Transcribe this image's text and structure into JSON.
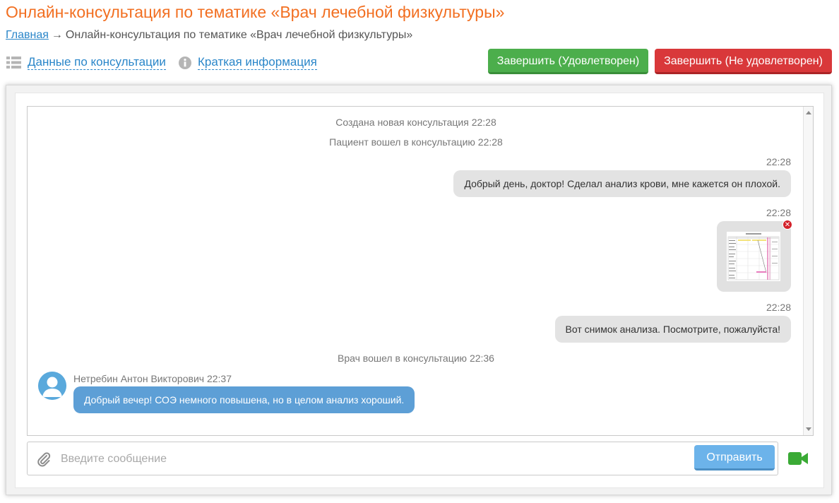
{
  "page": {
    "title": "Онлайн-консультация по тематике «Врач лечебной физкультуры»"
  },
  "breadcrumb": {
    "home": "Главная",
    "arrow": "→",
    "current": "Онлайн-консультация по тематике «Врач лечебной физкультуры»"
  },
  "toolbar": {
    "data_link": "Данные по консультации",
    "data_icon": "list-icon",
    "info_link": "Краткая информация",
    "info_icon": "info-icon",
    "finish_ok": "Завершить (Удовлетворен)",
    "finish_bad": "Завершить (Не удовлетворен)"
  },
  "chat": {
    "events": [
      {
        "text": "Создана новая консультация",
        "time": "22:28"
      },
      {
        "text": "Пациент вошел в консультацию",
        "time": "22:28"
      },
      {
        "text": "Врач вошел в консультацию",
        "time": "22:36"
      }
    ],
    "outgoing": [
      {
        "time": "22:28",
        "text": "Добрый день, доктор! Сделал анализ крови, мне кажется он плохой."
      },
      {
        "time": "22:28",
        "attachment": "image",
        "delete_icon": "remove-icon"
      },
      {
        "time": "22:28",
        "text": "Вот снимок анализа. Посмотрите, пожалуйста!"
      }
    ],
    "incoming": [
      {
        "author": "Нетребин Антон Викторович",
        "time": "22:37",
        "text": "Добрый вечер! СОЭ немного повышена, но в целом анализ хороший."
      }
    ]
  },
  "composer": {
    "placeholder": "Введите сообщение",
    "value": "",
    "send_label": "Отправить",
    "attach_icon": "paperclip-icon",
    "video_icon": "video-camera-icon"
  },
  "colors": {
    "title": "#f26f21",
    "link": "#2a86c9",
    "finish_ok": "#4cae4c",
    "finish_bad": "#d9383a",
    "incoming_bubble": "#5d9fd6",
    "outgoing_bubble": "#e3e3e3",
    "send_button": "#6cb3ea",
    "video_icon": "#3aaa35"
  }
}
